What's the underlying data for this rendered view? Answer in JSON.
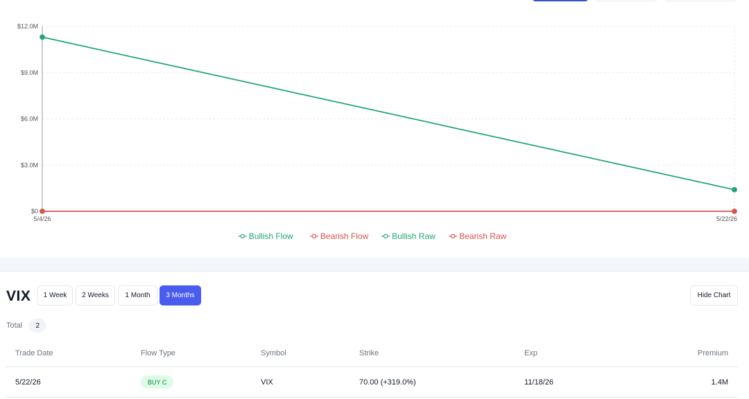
{
  "chart_data": {
    "type": "line",
    "x": [
      "5/4/26",
      "5/22/26"
    ],
    "y_ticks": [
      "$0",
      "$3.0M",
      "$6.0M",
      "$9.0M",
      "$12.0M"
    ],
    "ylim": [
      0,
      12000000
    ],
    "grid": true,
    "legend_position": "bottom-center",
    "series": [
      {
        "name": "Bullish Flow",
        "color": "#22a673",
        "values": [
          11300000,
          1400000
        ]
      },
      {
        "name": "Bearish Flow",
        "color": "#d9534f",
        "values": [
          0,
          0
        ]
      },
      {
        "name": "Bullish Raw",
        "color": "#22a673",
        "values": [
          11300000,
          1400000
        ]
      },
      {
        "name": "Bearish Raw",
        "color": "#d9534f",
        "values": [
          0,
          0
        ]
      }
    ]
  },
  "controls": {
    "symbol_title": "VIX",
    "ranges": [
      {
        "label": "1 Week",
        "active": false
      },
      {
        "label": "2 Weeks",
        "active": false
      },
      {
        "label": "1 Month",
        "active": false
      },
      {
        "label": "3 Months",
        "active": true
      }
    ],
    "hide_chart_label": "Hide Chart"
  },
  "summary": {
    "total_label": "Total",
    "total_count": "2"
  },
  "table": {
    "headers": [
      "Trade Date",
      "Flow Type",
      "Symbol",
      "Strike",
      "Exp",
      "Premium"
    ],
    "rows": [
      {
        "trade_date": "5/22/26",
        "flow_type": "BUY C",
        "symbol": "VIX",
        "strike": "70.00 (+319.0%)",
        "exp": "11/18/26",
        "premium": "1.4M"
      }
    ]
  }
}
